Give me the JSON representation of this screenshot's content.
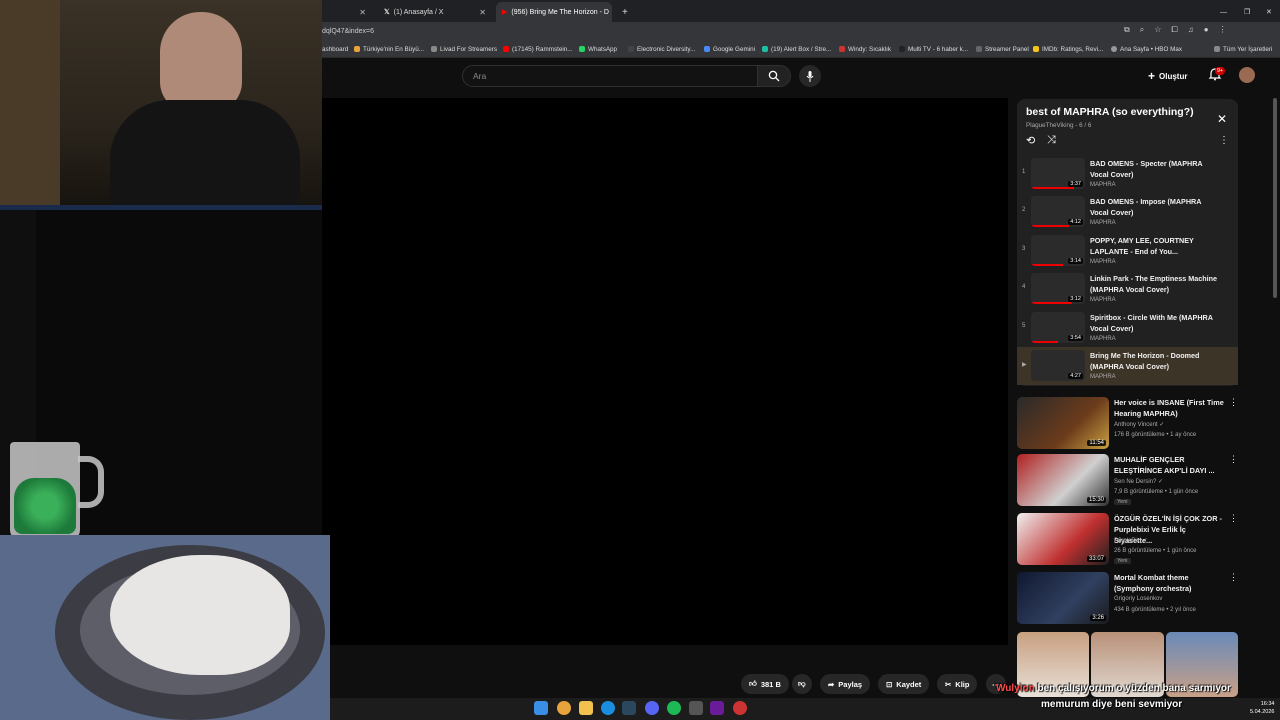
{
  "browser": {
    "tabs": [
      {
        "label": "",
        "active": false
      },
      {
        "label": "(1) Anasayfa / X",
        "active": false
      },
      {
        "label": "(956) Bring Me The Horizon - D",
        "active": true
      }
    ],
    "url": "dqlQ47&index=6",
    "bookmarks": [
      "ashboard",
      "Türkiye'nin En Büyü...",
      "Livad For Streamers",
      "(17145) Rammstein...",
      "WhatsApp",
      "Electronic Diversity...",
      "Google Gemini",
      "(19) Alert Box / Stre...",
      "Windy: Sıcaklık",
      "Multi TV - 6 haber k...",
      "Streamer Panel",
      "IMDb: Ratings, Revi...",
      "Ana Sayfa • HBO Max",
      "Tüm Yer İşaretleri"
    ]
  },
  "header": {
    "search_placeholder": "Ara",
    "create_label": "Oluştur",
    "notif_count": "9+"
  },
  "playlist": {
    "title": "best of MAPHRA (so everything?)",
    "subtitle": "PlagueTheViking - 6 / 6",
    "items": [
      {
        "idx": "1",
        "title": "BAD OMENS - Specter (MAPHRA Vocal Cover)",
        "channel": "MAPHRA",
        "duration": "3:37"
      },
      {
        "idx": "2",
        "title": "BAD OMENS - Impose (MAPHRA Vocal Cover)",
        "channel": "MAPHRA",
        "duration": "4:12"
      },
      {
        "idx": "3",
        "title": "POPPY, AMY LEE, COURTNEY LAPLANTE - End of You...",
        "channel": "MAPHRA",
        "duration": "3:14"
      },
      {
        "idx": "4",
        "title": "Linkin Park - The Emptiness Machine (MAPHRA Vocal Cover)",
        "channel": "MAPHRA",
        "duration": "3:12"
      },
      {
        "idx": "5",
        "title": "Spiritbox - Circle With Me (MAPHRA Vocal Cover)",
        "channel": "MAPHRA",
        "duration": "3:54"
      },
      {
        "idx": "▶",
        "title": "Bring Me The Horizon - Doomed (MAPHRA Vocal Cover)",
        "channel": "MAPHRA",
        "duration": "4:27"
      }
    ]
  },
  "recommendations": [
    {
      "title": "Her voice is INSANE (First Time Hearing MAPHRA)",
      "channel": "Anthony Vincent ✓",
      "meta": "176 B görüntüleme • 1 ay önce",
      "duration": "11:54",
      "badge": ""
    },
    {
      "title": "MUHALİF GENÇLER ELEŞTİRİNCE AKP'Lİ DAYI ...",
      "channel": "Sen Ne Dersin? ✓",
      "meta": "7,9 B görüntüleme • 1 gün önce",
      "duration": "15:30",
      "badge": "Yeni"
    },
    {
      "title": "ÖZGÜR ÖZEL'İN İŞİ ÇOK ZOR - Purplebixi Ve Erlik İç Siyasette...",
      "channel": "PurpleBixi ✓",
      "meta": "26 B görüntüleme • 1 gün önce",
      "duration": "33:07",
      "badge": "Yeni"
    },
    {
      "title": "Mortal Kombat theme (Symphony orchestra)",
      "channel": "Grigoriy Losenkov",
      "meta": "434 B görüntüleme • 2 yıl önce",
      "duration": "3:26",
      "badge": ""
    }
  ],
  "actions": {
    "likes": "381 B",
    "share": "Paylaş",
    "save": "Kaydet",
    "clip": "Klip"
  },
  "overlay": {
    "chat_user": "Wulyion",
    "chat_line1": " ben çalışıyorum o yüzden bana sarmıyor",
    "chat_line2": "memurum diye beni sevmiyor"
  },
  "clock": {
    "time": "16:34",
    "date": "5.04.2026"
  },
  "colors": {
    "bg": "#0f0f0f",
    "accent": "#ff0000",
    "card": "#212121"
  }
}
